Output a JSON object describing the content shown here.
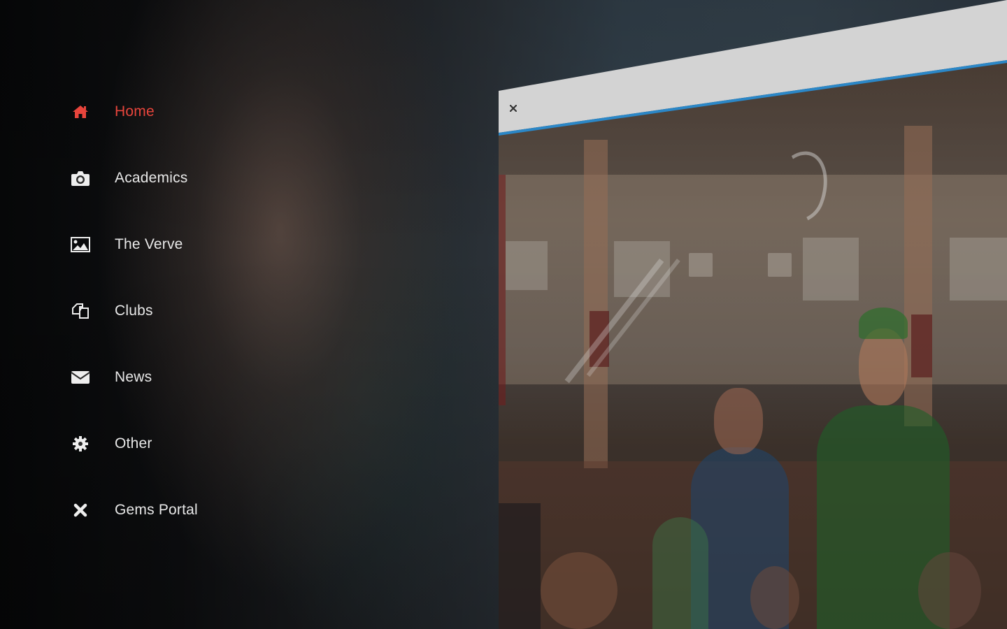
{
  "menu": {
    "items": [
      {
        "label": "Home",
        "icon": "home-icon",
        "active": true
      },
      {
        "label": "Academics",
        "icon": "camera-icon",
        "active": false
      },
      {
        "label": "The Verve",
        "icon": "image-icon",
        "active": false
      },
      {
        "label": "Clubs",
        "icon": "copy-icon",
        "active": false
      },
      {
        "label": "News",
        "icon": "envelope-icon",
        "active": false
      },
      {
        "label": "Other",
        "icon": "gear-icon",
        "active": false
      },
      {
        "label": "Gems Portal",
        "icon": "x-icon",
        "active": false
      }
    ]
  },
  "panel": {
    "close_glyph": "x",
    "photo": "school-event-photo"
  },
  "colors": {
    "accent": "#e8453c",
    "menu_text": "#e8e8e8",
    "panel_bar": "#d3d3d3",
    "panel_bar_line": "#2b87c7"
  }
}
